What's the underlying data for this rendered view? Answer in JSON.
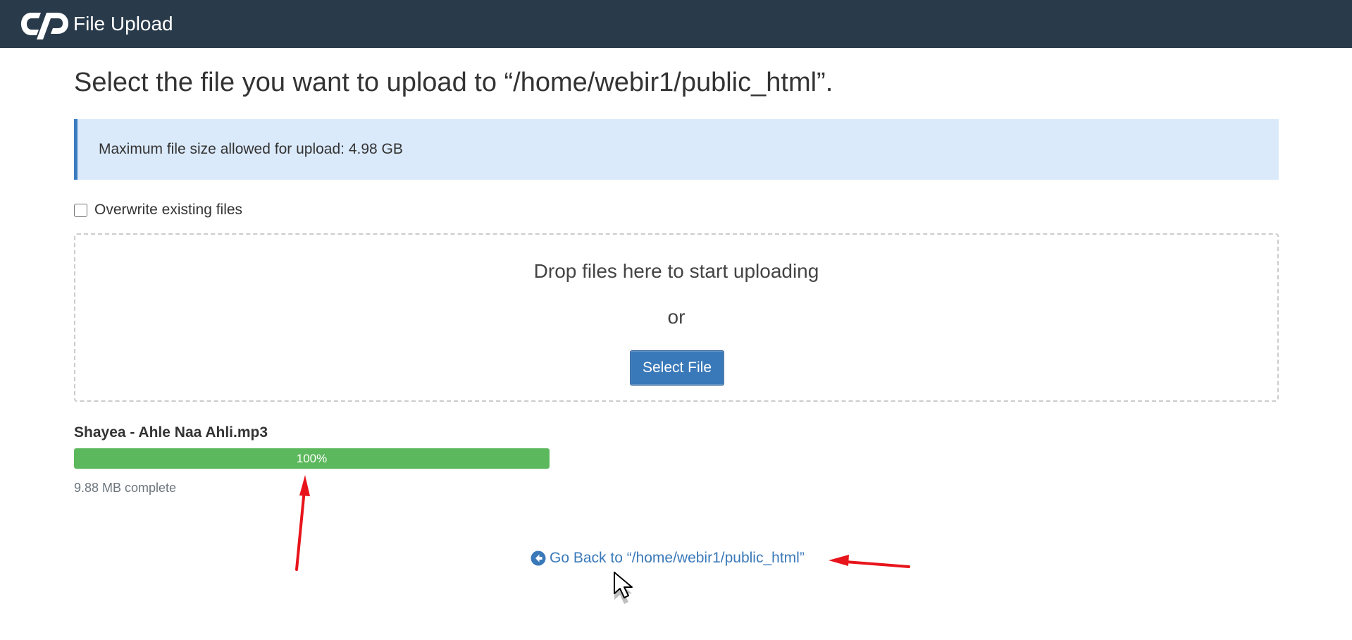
{
  "header": {
    "app_title": "File Upload",
    "logo_icon": "cpanel-logo-icon",
    "background_color": "#293a4a"
  },
  "main": {
    "heading": "Select the file you want to upload to “/home/webir1/public_html”.",
    "info_text": "Maximum file size allowed for upload: 4.98 GB",
    "overwrite_label": "Overwrite existing files",
    "overwrite_checked": false,
    "drop_zone": {
      "drop_text": "Drop files here to start uploading",
      "or_text": "or",
      "select_button_label": "Select File"
    },
    "upload": {
      "file_name": "Shayea - Ahle Naa Ahli.mp3",
      "progress_label": "100%",
      "progress_fraction": 1.0,
      "status": "9.88 MB complete",
      "progress_color": "#5cb85c"
    },
    "go_back": {
      "icon": "arrow-circle-left-icon",
      "label": "Go Back to “/home/webir1/public_html”"
    }
  },
  "colors": {
    "accent": "#3a79b9",
    "info_bg": "#dbeafa",
    "annotation": "#e8141b"
  }
}
